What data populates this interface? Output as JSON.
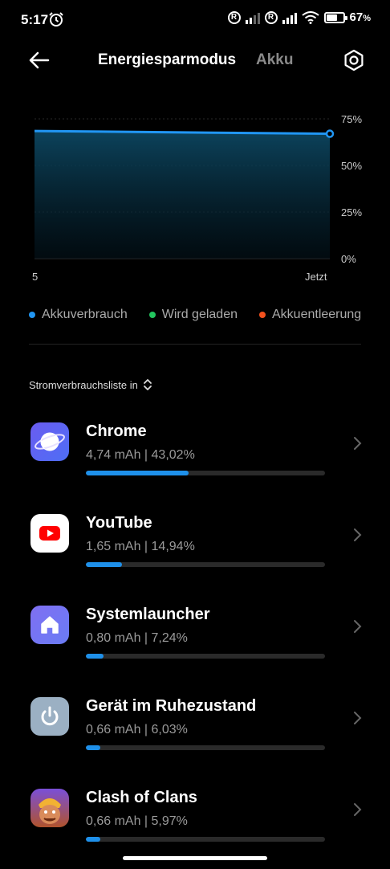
{
  "status_bar": {
    "time": "5:17",
    "battery_percent": "67",
    "battery_level": 0.67
  },
  "header": {
    "tab_active": "Energiesparmodus",
    "tab_inactive": "Akku"
  },
  "chart_data": {
    "type": "line",
    "x_labels": [
      "5",
      "Jetzt"
    ],
    "y_ticks": [
      "75%",
      "50%",
      "25%",
      "0%"
    ],
    "ylim": [
      0,
      75
    ],
    "series": [
      {
        "name": "Akkuverbrauch",
        "values": [
          68.5,
          67
        ]
      }
    ],
    "grid": true
  },
  "legend": [
    {
      "label": "Akkuverbrauch",
      "color": "#2196f3"
    },
    {
      "label": "Wird geladen",
      "color": "#22c55e"
    },
    {
      "label": "Akkuentleerung",
      "color": "#f4511e"
    }
  ],
  "list_header": "Stromverbrauchsliste in",
  "apps": [
    {
      "name": "Chrome",
      "stats": "4,74 mAh | 43,02%",
      "share": 0.4302,
      "icon": "planet-icon"
    },
    {
      "name": "YouTube",
      "stats": "1,65 mAh | 14,94%",
      "share": 0.1494,
      "icon": "youtube-icon"
    },
    {
      "name": "Systemlauncher",
      "stats": "0,80 mAh | 7,24%",
      "share": 0.0724,
      "icon": "home-icon"
    },
    {
      "name": "Gerät im Ruhezustand",
      "stats": "0,66 mAh | 6,03%",
      "share": 0.0603,
      "icon": "power-icon"
    },
    {
      "name": "Clash of Clans",
      "stats": "0,66 mAh | 5,97%",
      "share": 0.0597,
      "icon": "game-icon"
    }
  ]
}
